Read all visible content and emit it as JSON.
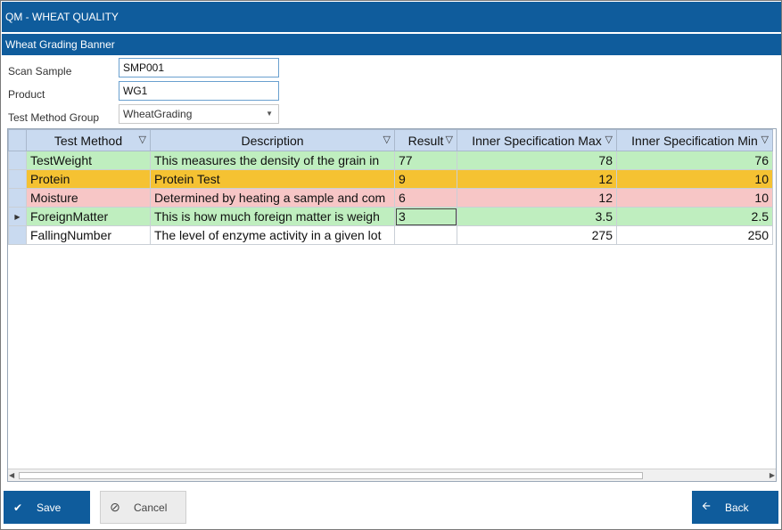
{
  "app": {
    "title": "QM - WHEAT QUALITY",
    "banner": "Wheat Grading Banner"
  },
  "form": {
    "scan_sample_label": "Scan Sample",
    "scan_sample_value": "SMP001",
    "product_label": "Product",
    "product_value": "WG1",
    "test_method_group_label": "Test Method Group",
    "test_method_group_value": "WheatGrading"
  },
  "grid": {
    "columns": [
      "Test Method",
      "Description",
      "Result",
      "Inner Specification Max",
      "Inner Specification Min"
    ],
    "rows": [
      {
        "method": "TestWeight",
        "description": "This measures the density of the grain in",
        "result": "77",
        "max": "78",
        "min": "76",
        "status": "green"
      },
      {
        "method": "Protein",
        "description": "Protein Test",
        "result": "9",
        "max": "12",
        "min": "10",
        "status": "orange"
      },
      {
        "method": "Moisture",
        "description": "Determined by heating a sample and com",
        "result": "6",
        "max": "12",
        "min": "10",
        "status": "red"
      },
      {
        "method": "ForeignMatter",
        "description": "This is how much foreign matter is weigh",
        "result": "3",
        "max": "3.5",
        "min": "2.5",
        "status": "green"
      },
      {
        "method": "FallingNumber",
        "description": "The level of enzyme activity in a given lot",
        "result": "",
        "max": "275",
        "min": "250",
        "status": "white"
      }
    ],
    "row_colors": {
      "green": "#bfeebf",
      "orange": "#f5c232",
      "red": "#f7c6c6",
      "white": "#ffffff"
    }
  },
  "buttons": {
    "save": "Save",
    "cancel": "Cancel",
    "back": "Back"
  },
  "colors": {
    "brand": "#0f5c9c",
    "header": "#c9daf0"
  }
}
